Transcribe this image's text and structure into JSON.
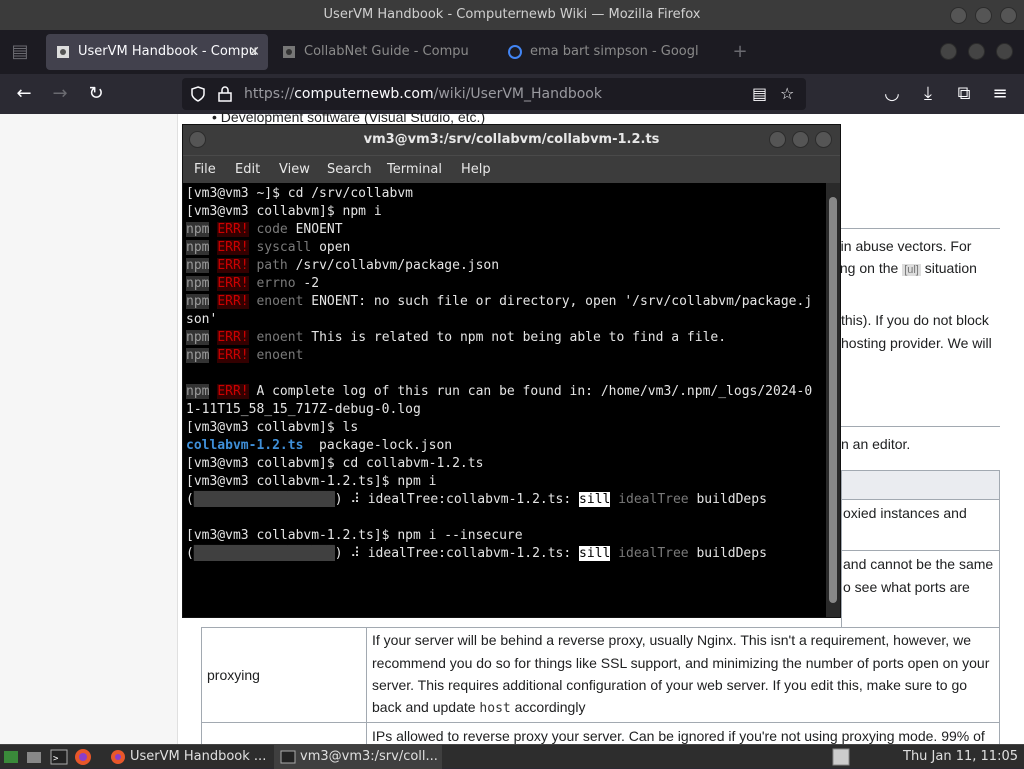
{
  "browser": {
    "window_title": "UserVM Handbook - Computernewb Wiki — Mozilla Firefox",
    "tabs": [
      {
        "label": "UserVM Handbook - Compu",
        "active": true
      },
      {
        "label": "CollabNet Guide - Compu",
        "active": false
      },
      {
        "label": "ema bart simpson - Googl",
        "active": false
      }
    ],
    "url_protocol": "https://",
    "url_host": "computernewb.com",
    "url_path": "/wiki/UserVM_Handbook"
  },
  "page": {
    "bullet_partial": "Development software (Visual Studio, etc.)",
    "frag1": "tain abuse vectors. For",
    "frag2a": "ding on the",
    "frag2b": "situation",
    "frag3": "this). If you do not block",
    "frag4": "hosting provider. We will",
    "frag5": "n an editor.",
    "frag6": "oxied instances and",
    "frag7": "and cannot be the same",
    "frag8": "o see what ports are",
    "proxying_label": "proxying",
    "proxying_desc_1": "If your server will be behind a reverse proxy, usually Nginx. This isn't a requirement, however, we",
    "proxying_desc_2": "recommend you do so for things like SSL support, and minimizing the number of ports open on your",
    "proxying_desc_3": "server. This requires additional configuration of your web server. If you edit this, make sure to go",
    "proxying_desc_4a": "back and update",
    "proxying_desc_4code": "host",
    "proxying_desc_4b": "accordingly",
    "next_row_partial": "IPs allowed to reverse proxy your server. Can be ignored if you're not using proxying mode. 99% of"
  },
  "terminal": {
    "title": "vm3@vm3:/srv/collabvm/collabvm-1.2.ts",
    "menu": [
      "File",
      "Edit",
      "View",
      "Search",
      "Terminal",
      "Help"
    ],
    "npm": "npm",
    "err": "ERR!",
    "lines": {
      "l1": "[vm3@vm3 ~]$ cd /srv/collabvm",
      "l2": "[vm3@vm3 collabvm]$ npm i",
      "l3k": "code",
      "l3v": "ENOENT",
      "l4k": "syscall",
      "l4v": "open",
      "l5k": "path",
      "l5v": "/srv/collabvm/package.json",
      "l6k": "errno",
      "l6v": "-2",
      "l7k": "enoent",
      "l7v": "ENOENT: no such file or directory, open '/srv/collabvm/package.j",
      "l8": "son'",
      "l9k": "enoent",
      "l9v": "This is related to npm not being able to find a file.",
      "l10k": "enoent",
      "l11v": "A complete log of this run can be found in: /home/vm3/.npm/_logs/2024-0",
      "l12": "1-11T15_58_15_717Z-debug-0.log",
      "l13": "[vm3@vm3 collabvm]$ ls",
      "l14a": "collabvm-1.2.ts",
      "l14b": "  package-lock.json",
      "l15": "[vm3@vm3 collabvm]$ cd collabvm-1.2.ts",
      "l16": "[vm3@vm3 collabvm-1.2.ts]$ npm i",
      "spin_text": " ⠼ idealTree:collabvm-1.2.ts: ",
      "sill": "sill",
      "idealtree": "idealTree",
      "builddeps": "buildDeps",
      "l18": "[vm3@vm3 collabvm-1.2.ts]$ npm i --insecure"
    }
  },
  "taskbar": {
    "items": [
      "UserVM Handbook ...",
      "vm3@vm3:/srv/coll..."
    ],
    "clock": "Thu Jan 11, 11:05"
  }
}
